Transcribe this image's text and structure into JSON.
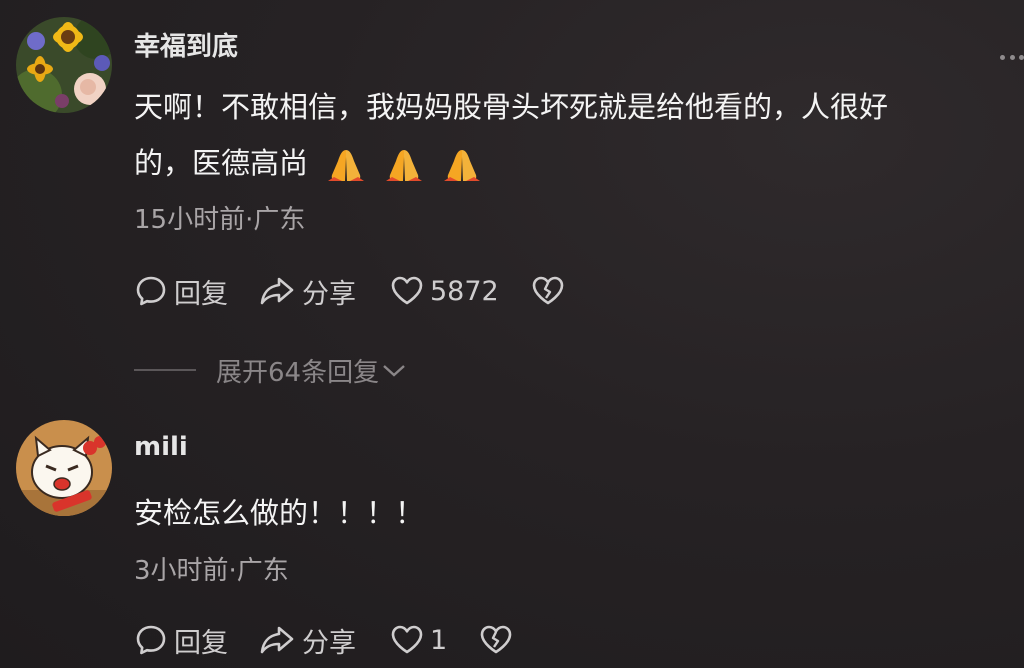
{
  "comments": [
    {
      "username": "幸福到底",
      "text_line1": "天啊！不敢相信，我妈妈股骨头坏死就是给他看的，人很好",
      "text_line2": "的，医德高尚",
      "emoji_icon": "folded-hands-icon",
      "emoji_count": 3,
      "meta": "15小时前·广东",
      "reply_label": "回复",
      "share_label": "分享",
      "like_count": "5872",
      "expand_label": "展开64条回复"
    },
    {
      "username": "mili",
      "text_line1": "安检怎么做的！！！！",
      "meta": "3小时前·广东",
      "reply_label": "回复",
      "share_label": "分享",
      "like_count": "1"
    }
  ],
  "icons": {
    "reply": "comment-bubble-icon",
    "share": "share-arrow-icon",
    "like": "heart-icon",
    "dislike": "broken-heart-icon",
    "more": "more-dots-icon",
    "expand": "chevron-down-icon"
  },
  "colors": {
    "background": "#262224",
    "text": "#f4f4f4",
    "secondary": "#a9a5a7",
    "emoji": "#f5a623"
  }
}
